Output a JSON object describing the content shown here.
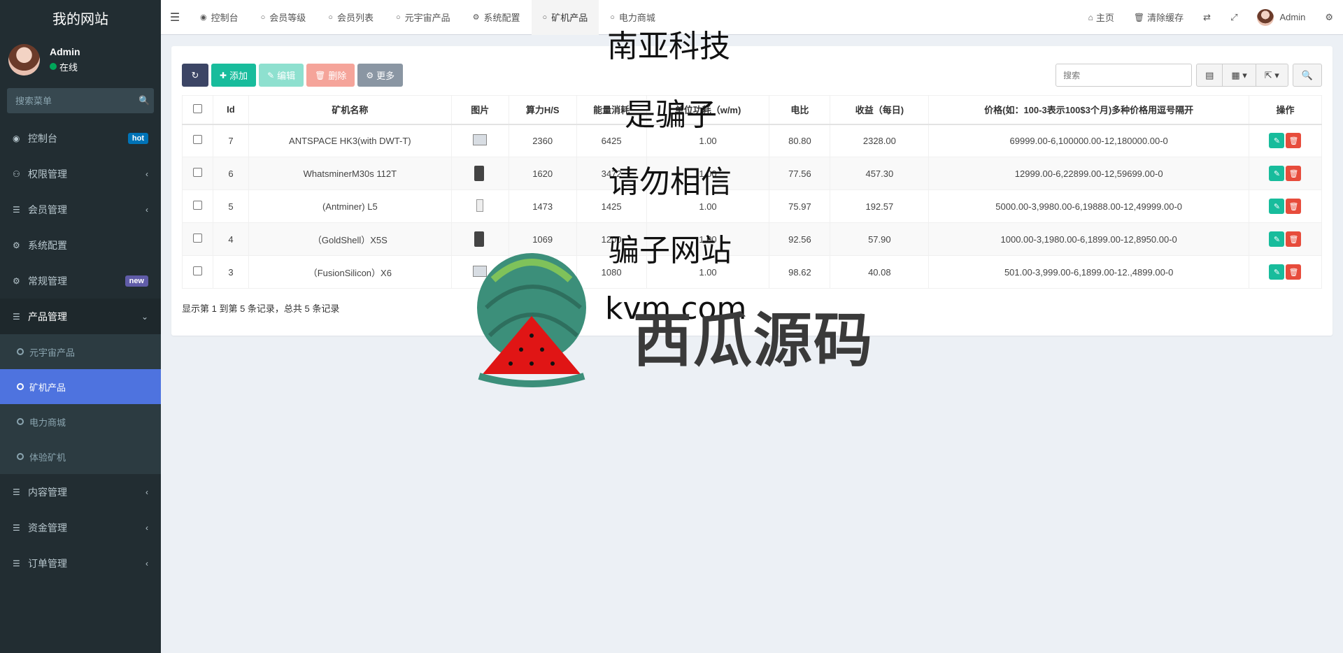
{
  "sidebar": {
    "logo": "我的网站",
    "user": {
      "name": "Admin",
      "status": "在线"
    },
    "search_placeholder": "搜索菜单",
    "items": [
      {
        "label": "控制台",
        "badge": "hot",
        "icon": "dashboard-icon"
      },
      {
        "label": "权限管理",
        "icon": "users-icon"
      },
      {
        "label": "会员管理",
        "icon": "list-icon"
      },
      {
        "label": "系统配置",
        "icon": "gear-icon"
      },
      {
        "label": "常规管理",
        "badge": "new",
        "icon": "cogs-icon"
      },
      {
        "label": "产品管理",
        "icon": "list-icon"
      },
      {
        "label": "内容管理",
        "icon": "list-icon"
      },
      {
        "label": "资金管理",
        "icon": "list-icon"
      },
      {
        "label": "订单管理",
        "icon": "list-icon"
      }
    ],
    "submenu": [
      "元宇宙产品",
      "矿机产品",
      "电力商城",
      "体验矿机"
    ]
  },
  "topbar": {
    "tabs": [
      "控制台",
      "会员等级",
      "会员列表",
      "元宇宙产品",
      "系统配置",
      "矿机产品",
      "电力商城"
    ],
    "home": "主页",
    "clear_cache": "清除缓存",
    "admin": "Admin"
  },
  "toolbar": {
    "add": "添加",
    "edit": "编辑",
    "delete": "删除",
    "more": "更多",
    "search_placeholder": "搜索"
  },
  "table": {
    "headers": [
      "Id",
      "矿机名称",
      "图片",
      "算力H/S",
      "能量消耗",
      "单位功耗（w/m)",
      "电比",
      "收益（每日)",
      "价格(如：100-3表示100$3个月)多种价格用逗号隔开",
      "操作"
    ],
    "rows": [
      [
        "7",
        "ANTSPACE HK3(with DWT-T)",
        "",
        "2360",
        "6425",
        "1.00",
        "80.80",
        "2328.00",
        "69999.00-6,100000.00-12,180000.00-0"
      ],
      [
        "6",
        "WhatsminerM30s 112T",
        "",
        "1620",
        "3472",
        "1.00",
        "77.56",
        "457.30",
        "12999.00-6,22899.00-12,59699.00-0"
      ],
      [
        "5",
        "(Antminer) L5",
        "",
        "1473",
        "1425",
        "1.00",
        "75.97",
        "192.57",
        "5000.00-3,9980.00-6,19888.00-12,49999.00-0"
      ],
      [
        "4",
        "（GoldShell）X5S",
        "",
        "1069",
        "1200",
        "1.00",
        "92.56",
        "57.90",
        "1000.00-3,1980.00-6,1899.00-12,8950.00-0"
      ],
      [
        "3",
        "（FusionSilicon）X6",
        "",
        "1080",
        "1080",
        "1.00",
        "98.62",
        "40.08",
        "501.00-3,999.00-6,1899.00-12.,4899.00-0"
      ]
    ],
    "summary": "显示第 1 到第 5 条记录，总共 5 条记录"
  },
  "watermark": {
    "lines": [
      "南亚科技",
      "是骗子",
      "请勿相信",
      "骗子网站",
      "kvm.com"
    ],
    "brand": "西瓜源码"
  }
}
